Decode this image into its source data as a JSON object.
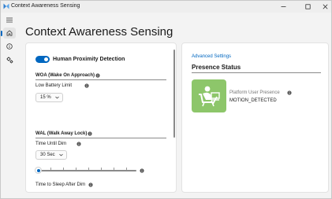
{
  "window": {
    "title": "Context Awareness Sensing"
  },
  "nav": {
    "items": [
      {
        "name": "menu",
        "icon": "hamburger-icon"
      },
      {
        "name": "home",
        "icon": "home-icon",
        "selected": true
      },
      {
        "name": "info",
        "icon": "info-icon"
      },
      {
        "name": "settings",
        "icon": "settings-icon"
      }
    ]
  },
  "page": {
    "title": "Context Awareness Sensing"
  },
  "settings": {
    "hpd_label": "Human Proximity Detection",
    "hpd_enabled": true,
    "woa_heading": "WOA (Wake On Approach)",
    "low_battery_label": "Low Battery Limit",
    "low_battery_value": "15 %",
    "wal_heading": "WAL (Walk Away Lock)",
    "time_until_dim_label": "Time Until Dim",
    "time_until_dim_value": "30 Sec",
    "slider_position": 0.0,
    "time_to_sleep_label": "Time to Sleep After Dim"
  },
  "presence": {
    "advanced_link": "Advanced Settings",
    "title": "Presence Status",
    "user_presence_label": "Platform User Presence",
    "user_presence_value": "MOTION_DETECTED",
    "tile_color": "#8dc66a"
  },
  "colors": {
    "accent": "#0067c0"
  }
}
